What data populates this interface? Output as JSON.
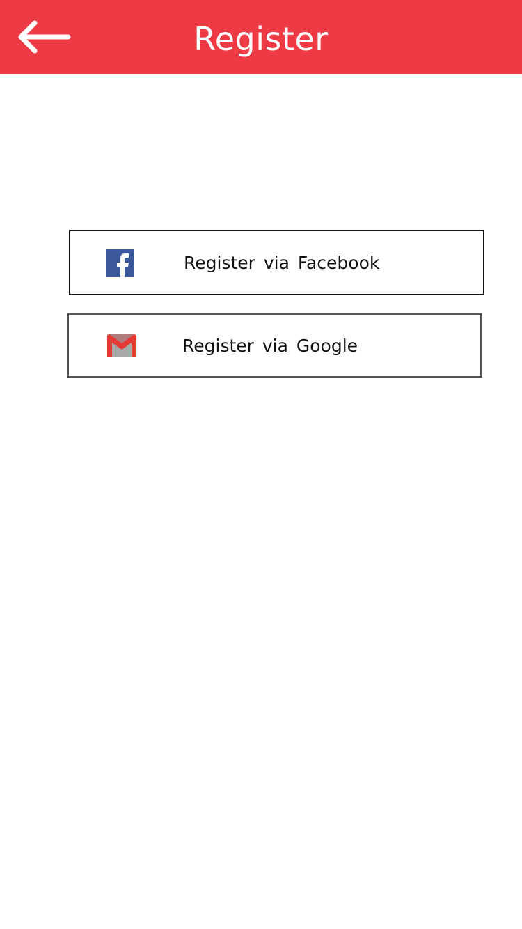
{
  "header": {
    "title": "Register",
    "back_icon": "arrow-left-icon",
    "background_color": "#ee3a44",
    "text_color": "#ffffff"
  },
  "buttons": {
    "facebook": {
      "label": "Register via Facebook",
      "icon": "facebook-icon",
      "icon_color": "#3b5998"
    },
    "google": {
      "label": "Register via Google",
      "icon": "gmail-icon",
      "icon_color": "#e53935"
    }
  }
}
